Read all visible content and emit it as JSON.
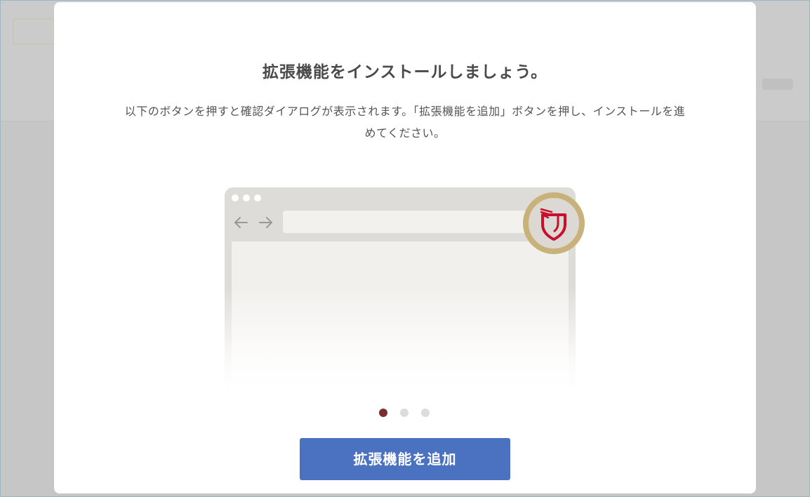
{
  "modal": {
    "title": "拡張機能をインストールしましょう。",
    "description": "以下のボタンを押すと確認ダイアログが表示されます。「拡張機能を追加」ボタンを押し、インストールを進めてください。",
    "add_button_label": "拡張機能を追加"
  },
  "illustration": {
    "back_icon": "arrow-left-icon",
    "forward_icon": "arrow-right-icon",
    "extension_icon": "shield-logo-icon"
  },
  "pager": {
    "count": 3,
    "active_index": 0
  },
  "colors": {
    "accent": "#4a72c0",
    "pager_active": "#7a2e2e",
    "badge_ring": "#c8b27a",
    "logo_red": "#c8102e"
  }
}
